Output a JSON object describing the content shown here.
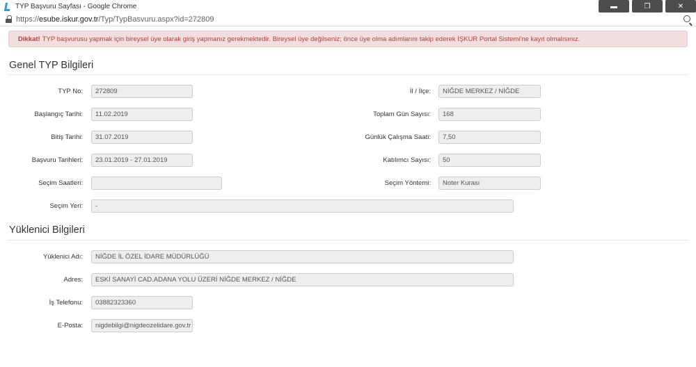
{
  "window": {
    "title": "TYP Başvuru Sayfası - Google Chrome",
    "controls": {
      "minimize": "▬",
      "restore": "❐",
      "close": "✕"
    }
  },
  "address": {
    "protocol": "https://",
    "host": "esube.iskur.gov.tr",
    "path": "/Typ/TypBasvuru.aspx?id=272809"
  },
  "alert": {
    "strong": "Dikkat!",
    "text": "TYP başvurusu yapmak için bireysel üye olarak giriş yapmanız gerekmektedir. Bireysel üye değilseniz; önce üye olma adımlarını takip ederek İŞKUR Portal Sistemi'ne kayıt olmalısınız."
  },
  "general": {
    "title": "Genel TYP Bilgileri",
    "typ_no": {
      "label": "TYP No:",
      "value": "272809"
    },
    "baslangic": {
      "label": "Başlangıç Tarihi:",
      "value": "11.02.2019"
    },
    "bitis": {
      "label": "Bitiş Tarihi:",
      "value": "31.07.2019"
    },
    "basvuru": {
      "label": "Başvuru Tarihleri:",
      "value": "23.01.2019 - 27.01.2019"
    },
    "secim_saatleri": {
      "label": "Seçim Saatleri:",
      "value": ""
    },
    "secim_yeri": {
      "label": "Seçim Yeri:",
      "value": "-"
    },
    "il_ilce": {
      "label": "İl / İlçe:",
      "value": "NİĞDE MERKEZ / NİĞDE"
    },
    "toplam_gun": {
      "label": "Toplam Gün Sayısı:",
      "value": "168"
    },
    "gunluk_saat": {
      "label": "Günlük Çalışma Saati:",
      "value": "7,50"
    },
    "katilimci": {
      "label": "Katılımcı Sayısı:",
      "value": "50"
    },
    "secim_yontemi": {
      "label": "Seçim Yöntemi:",
      "value": "Noter Kurası"
    }
  },
  "contractor": {
    "title": "Yüklenici Bilgileri",
    "ad": {
      "label": "Yüklenici Adı:",
      "value": "NİĞDE İL ÖZEL İDARE MÜDÜRLÜĞÜ"
    },
    "adres": {
      "label": "Adres:",
      "value": "ESKİ SANAYİ CAD.ADANA YOLU ÜZERİ  NİĞDE MERKEZ / NİĞDE"
    },
    "telefon": {
      "label": "İş Telefonu:",
      "value": "03882323360"
    },
    "eposta": {
      "label": "E-Posta:",
      "value": "nigdebilgi@nigdeozelidare.gov.tr"
    }
  }
}
